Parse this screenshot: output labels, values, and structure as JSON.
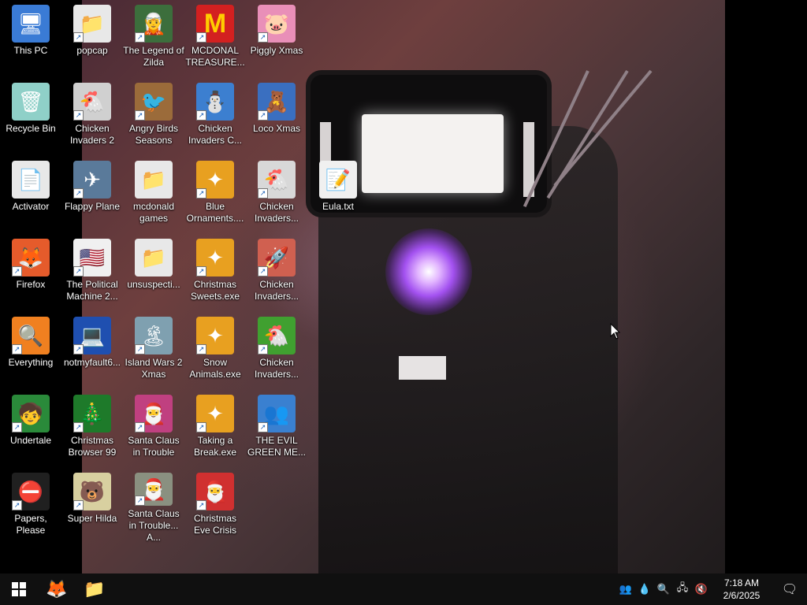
{
  "desktop": {
    "icons": [
      {
        "label": "This PC",
        "emoji": "🖥",
        "bg": "#3a7bd5"
      },
      {
        "label": "popcap",
        "emoji": "📁",
        "bg": "#e8e8e8"
      },
      {
        "label": "The Legend of Zilda",
        "emoji": "🧝",
        "bg": "#3c6e3c"
      },
      {
        "label": "MCDONAL TREASURE...",
        "emoji": "M",
        "bg": "#d32020"
      },
      {
        "label": "Piggly Xmas",
        "emoji": "🐷",
        "bg": "#e98fb8"
      },
      {
        "label": "Recycle Bin",
        "emoji": "🗑",
        "bg": "#8fd0c8"
      },
      {
        "label": "Chicken Invaders 2",
        "emoji": "🐔",
        "bg": "#d0d0d0"
      },
      {
        "label": "Angry Birds Seasons",
        "emoji": "🐦",
        "bg": "#9b6b3a"
      },
      {
        "label": "Chicken Invaders C...",
        "emoji": "⛄",
        "bg": "#3c7fd0"
      },
      {
        "label": "Loco Xmas",
        "emoji": "🧸",
        "bg": "#3a6fc0"
      },
      {
        "label": "Activator",
        "emoji": "📄",
        "bg": "#e8e8e8"
      },
      {
        "label": "Flappy Plane",
        "emoji": "✈",
        "bg": "#5a7a9a"
      },
      {
        "label": "mcdonald games",
        "emoji": "📁",
        "bg": "#e8e8e8"
      },
      {
        "label": "Blue Ornaments....",
        "emoji": "✦",
        "bg": "#e8a020"
      },
      {
        "label": "Chicken Invaders...",
        "emoji": "🐔",
        "bg": "#d8d8d8"
      },
      {
        "label": "Eula.txt",
        "emoji": "📝",
        "bg": "#f0f0f0"
      },
      {
        "label": "Firefox",
        "emoji": "🦊",
        "bg": "#e55b2b"
      },
      {
        "label": "The Political Machine 2...",
        "emoji": "🇺🇸",
        "bg": "#f0f0f0"
      },
      {
        "label": "unsuspecti...",
        "emoji": "📁",
        "bg": "#e8e8e8"
      },
      {
        "label": "Christmas Sweets.exe",
        "emoji": "✦",
        "bg": "#e8a020"
      },
      {
        "label": "Chicken Invaders...",
        "emoji": "🚀",
        "bg": "#d06050"
      },
      {
        "label": "Everything",
        "emoji": "🔍",
        "bg": "#f08020"
      },
      {
        "label": "notmyfault6...",
        "emoji": "💻",
        "bg": "#1f4fb0"
      },
      {
        "label": "Island Wars 2 Xmas",
        "emoji": "🏝",
        "bg": "#7fa0b0"
      },
      {
        "label": "Snow Animals.exe",
        "emoji": "✦",
        "bg": "#e8a020"
      },
      {
        "label": "Chicken Invaders...",
        "emoji": "🐔",
        "bg": "#40a030"
      },
      {
        "label": "Undertale",
        "emoji": "🧒",
        "bg": "#2a8a3a"
      },
      {
        "label": "Christmas Browser 99",
        "emoji": "🎄",
        "bg": "#1e7a2a"
      },
      {
        "label": "Santa Claus in Trouble",
        "emoji": "🎅",
        "bg": "#c04080"
      },
      {
        "label": "Taking a Break.exe",
        "emoji": "✦",
        "bg": "#e8a020"
      },
      {
        "label": "THE EVIL GREEN ME...",
        "emoji": "👥",
        "bg": "#3a80d0"
      },
      {
        "label": "Papers, Please",
        "emoji": "⛔",
        "bg": "#202020"
      },
      {
        "label": "Super Hilda",
        "emoji": "🐻",
        "bg": "#d8d0a0"
      },
      {
        "label": "Santa Claus in Trouble... A...",
        "emoji": "🎅",
        "bg": "#8a9080"
      },
      {
        "label": "Christmas Eve Crisis",
        "emoji": "🎅",
        "bg": "#d03030"
      }
    ]
  },
  "taskbar": {
    "start_label": "Start",
    "pinned": [
      {
        "name": "Firefox",
        "emoji": "🦊"
      },
      {
        "name": "File Explorer",
        "emoji": "📁"
      }
    ],
    "tray": [
      "👥",
      "💧",
      "🔍",
      "🖧",
      "🔇"
    ],
    "time": "7:18 AM",
    "date": "2/6/2025",
    "notification_glyph": "🗨"
  }
}
